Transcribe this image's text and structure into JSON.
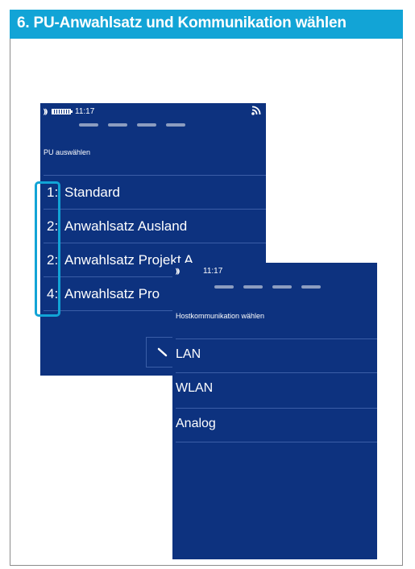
{
  "header": {
    "title": "6. PU-Anwahlsatz und Kommunikation wählen"
  },
  "screen1": {
    "status": {
      "signal_icon": "signal-icon",
      "battery_icon": "battery-icon",
      "time": "11:17",
      "wifi_icon": "wifi-icon"
    },
    "title": "PU auswählen",
    "items": [
      {
        "num": "1:",
        "label": "Standard"
      },
      {
        "num": "2:",
        "label": "Anwahlsatz Ausland"
      },
      {
        "num": "2:",
        "label": "Anwahlsatz Projekt A"
      },
      {
        "num": "4:",
        "label": "Anwahlsatz Pro"
      }
    ]
  },
  "screen2": {
    "status": {
      "signal_icon": "signal-icon",
      "time": "11:17"
    },
    "title": "Hostkommunikation wählen",
    "items": [
      {
        "label": "LAN"
      },
      {
        "label": "WLAN"
      },
      {
        "label": "Analog"
      }
    ]
  },
  "colors": {
    "header": "#12a4d6",
    "screen": "#0d327f",
    "highlight": "#12a4d6"
  }
}
